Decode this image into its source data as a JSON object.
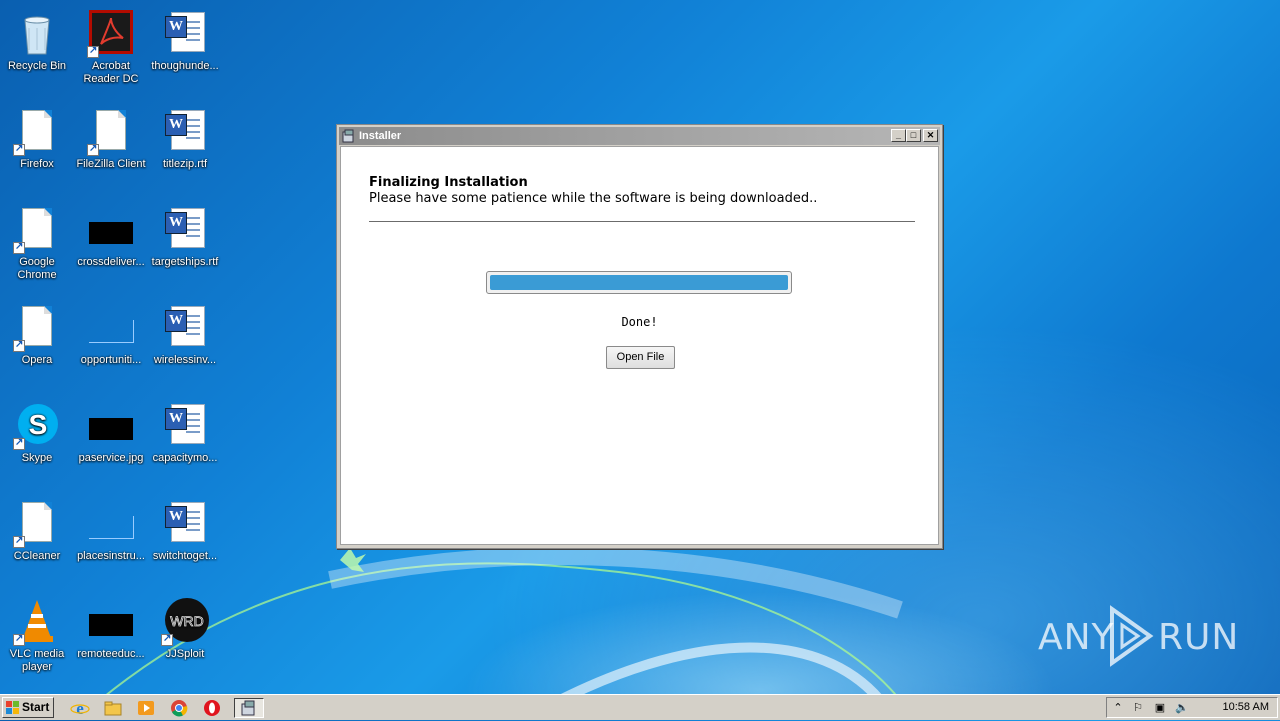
{
  "desktop": {
    "icons": [
      {
        "label": "Recycle Bin",
        "icon": "recycle-bin-icon"
      },
      {
        "label": "Acrobat Reader DC",
        "icon": "acrobat-icon"
      },
      {
        "label": "thoughunde...",
        "icon": "word-doc-icon"
      },
      {
        "label": "Firefox",
        "icon": "blank-doc-icon"
      },
      {
        "label": "FileZilla Client",
        "icon": "blank-doc-icon"
      },
      {
        "label": "titlezip.rtf",
        "icon": "word-doc-icon"
      },
      {
        "label": "Google Chrome",
        "icon": "blank-doc-icon"
      },
      {
        "label": "crossdeliver...",
        "icon": "black-image-icon"
      },
      {
        "label": "targetships.rtf",
        "icon": "word-doc-icon"
      },
      {
        "label": "Opera",
        "icon": "blank-doc-icon"
      },
      {
        "label": "opportuniti...",
        "icon": "image-icon"
      },
      {
        "label": "wirelessinv...",
        "icon": "word-doc-icon"
      },
      {
        "label": "Skype",
        "icon": "skype-icon"
      },
      {
        "label": "paservice.jpg",
        "icon": "black-image-icon"
      },
      {
        "label": "capacitymo...",
        "icon": "word-doc-icon"
      },
      {
        "label": "CCleaner",
        "icon": "blank-doc-icon"
      },
      {
        "label": "placesinstru...",
        "icon": "image-icon"
      },
      {
        "label": "switchtoget...",
        "icon": "word-doc-icon"
      },
      {
        "label": "VLC media player",
        "icon": "vlc-icon"
      },
      {
        "label": "remoteeduc...",
        "icon": "black-image-icon"
      },
      {
        "label": "JJSploit",
        "icon": "jjsploit-icon"
      }
    ]
  },
  "window": {
    "title": "Installer",
    "heading": "Finalizing Installation",
    "subtext": "Please have some patience while the software is being downloaded..",
    "progress_percent": 100,
    "status": "Done!",
    "open_button": "Open File",
    "controls": {
      "minimize": "_",
      "maximize": "□",
      "close": "✕"
    }
  },
  "taskbar": {
    "start_label": "Start",
    "pinned": [
      "internet-explorer-icon",
      "file-explorer-icon",
      "media-player-icon",
      "chrome-icon",
      "opera-icon",
      "installer-icon"
    ],
    "clock": "10:58 AM"
  },
  "watermark": {
    "left": "ANY",
    "right": "RUN"
  },
  "colors": {
    "progress": "#3a9bd5",
    "desktop": "#1181d6"
  }
}
